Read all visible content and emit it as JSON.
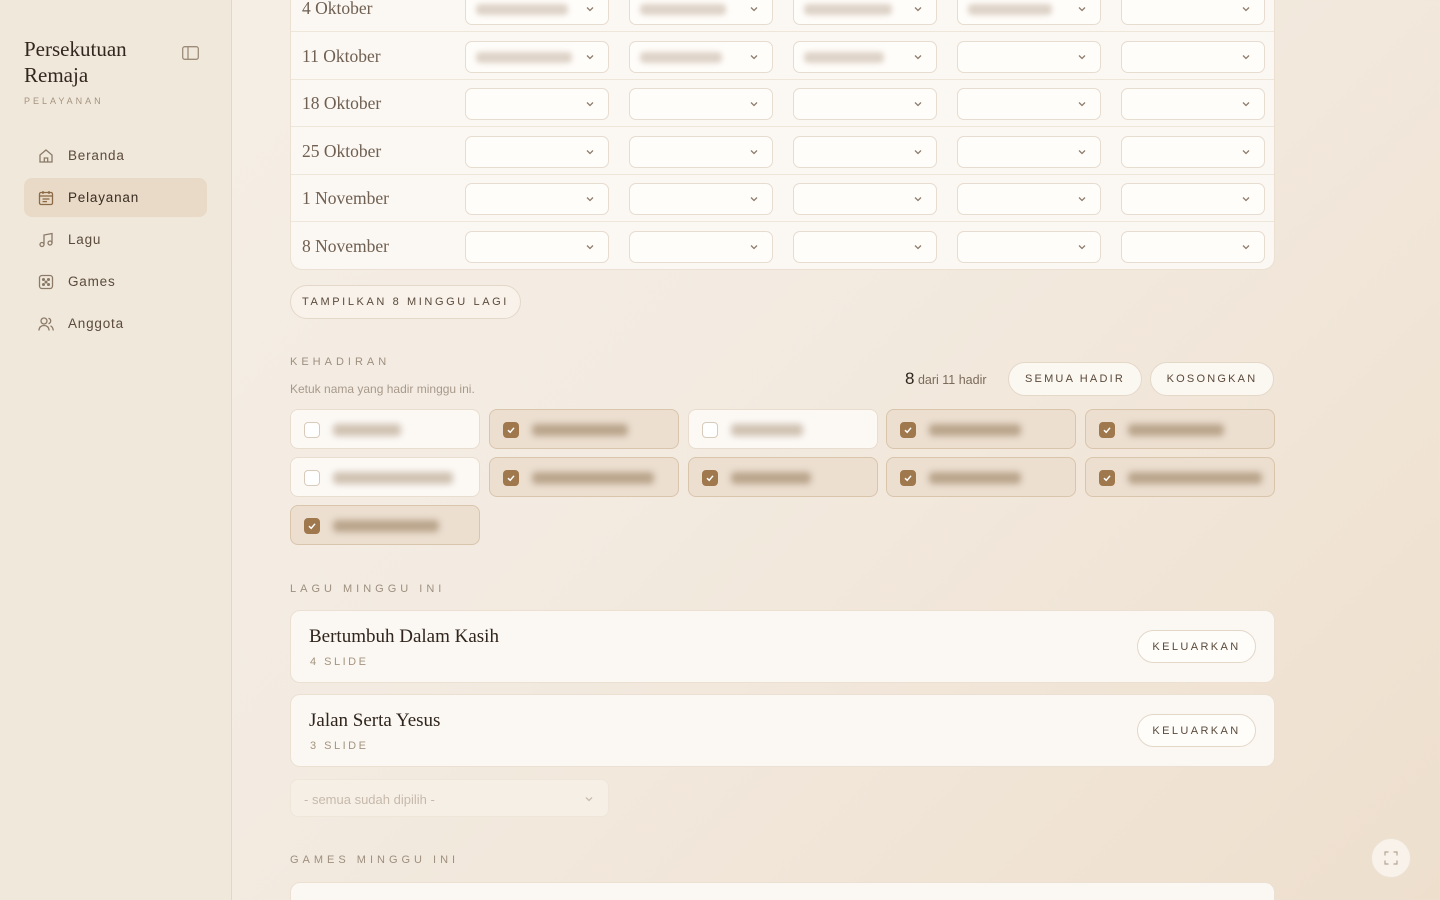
{
  "sidebar": {
    "title": "Persekutuan Remaja",
    "subtitle": "PELAYANAN",
    "items": [
      {
        "label": "Beranda",
        "icon": "home-icon",
        "active": false
      },
      {
        "label": "Pelayanan",
        "icon": "calendar-icon",
        "active": true
      },
      {
        "label": "Lagu",
        "icon": "music-icon",
        "active": false
      },
      {
        "label": "Games",
        "icon": "dice-icon",
        "active": false
      },
      {
        "label": "Anggota",
        "icon": "users-icon",
        "active": false
      }
    ]
  },
  "schedule": {
    "rows": [
      {
        "date": "4 Oktober",
        "filled": [
          true,
          true,
          true,
          true,
          false
        ]
      },
      {
        "date": "11 Oktober",
        "filled": [
          true,
          true,
          true,
          false,
          false
        ]
      },
      {
        "date": "18 Oktober",
        "filled": [
          false,
          false,
          false,
          false,
          false
        ]
      },
      {
        "date": "25 Oktober",
        "filled": [
          false,
          false,
          false,
          false,
          false
        ]
      },
      {
        "date": "1 November",
        "filled": [
          false,
          false,
          false,
          false,
          false
        ]
      },
      {
        "date": "8 November",
        "filled": [
          false,
          false,
          false,
          false,
          false
        ]
      }
    ],
    "more_button": "TAMPILKAN 8 MINGGU LAGI"
  },
  "attendance": {
    "label": "KEHADIRAN",
    "hint": "Ketuk nama yang hadir minggu ini.",
    "present": "8",
    "total_text": "dari 11 hadir",
    "all_button": "SEMUA HADIR",
    "clear_button": "KOSONGKAN",
    "members": [
      false,
      true,
      false,
      true,
      true,
      false,
      true,
      true,
      true,
      true,
      true
    ]
  },
  "songs": {
    "label": "LAGU MINGGU INI",
    "items": [
      {
        "title": "Bertumbuh Dalam Kasih",
        "slides": "4 SLIDE",
        "action": "KELUARKAN"
      },
      {
        "title": "Jalan Serta Yesus",
        "slides": "3 SLIDE",
        "action": "KELUARKAN"
      }
    ],
    "select_placeholder": "- semua sudah dipilih -"
  },
  "games": {
    "label": "GAMES MINGGU INI"
  },
  "colors": {
    "accent": "#a0784d",
    "background": "#f4ece2",
    "sidebar": "#f1e8dc"
  }
}
